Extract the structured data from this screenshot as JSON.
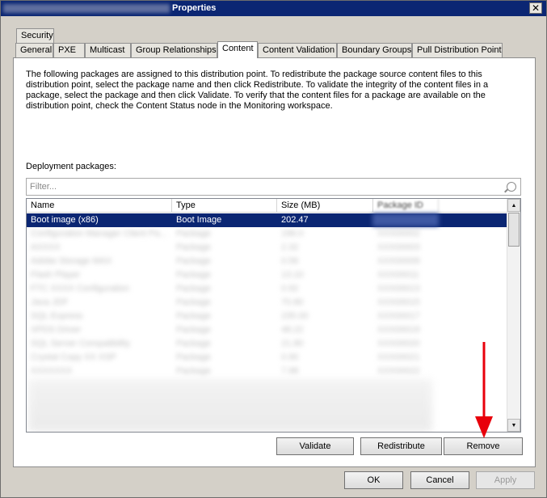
{
  "window": {
    "title": "Properties",
    "close_glyph": "✕"
  },
  "tabs": {
    "row1": [
      {
        "label": "Security"
      }
    ],
    "row2": [
      {
        "label": "General"
      },
      {
        "label": "PXE"
      },
      {
        "label": "Multicast"
      },
      {
        "label": "Group Relationships"
      },
      {
        "label": "Content",
        "active": true
      },
      {
        "label": "Content Validation"
      },
      {
        "label": "Boundary Groups"
      },
      {
        "label": "Pull Distribution Point"
      }
    ]
  },
  "content": {
    "description": "The following packages are assigned to this distribution point. To redistribute the package source content files to this distribution point, select the package name and then click Redistribute. To validate the integrity of the content files in a package, select the package and then click Validate. To verify that the content files for a package are available on the distribution point, check the Content Status node in the Monitoring workspace.",
    "deployment_label": "Deployment packages:",
    "filter_placeholder": "Filter...",
    "columns": {
      "name": "Name",
      "type": "Type",
      "size": "Size (MB)",
      "package_id": "Package ID"
    },
    "selected_row": {
      "name": "Boot image (x86)",
      "type": "Boot Image",
      "size": "202.47"
    },
    "blurred_rows": [
      {
        "name": "Configuration Manager Client Pa...",
        "type": "Package",
        "size": "196.0",
        "id": "XXX00002"
      },
      {
        "name": "AXXXX",
        "type": "Package",
        "size": "2.32",
        "id": "XXX00003"
      },
      {
        "name": "Adobe Storage MAX",
        "type": "Package",
        "size": "0.56",
        "id": "XXX00009"
      },
      {
        "name": "Flash Player",
        "type": "Package",
        "size": "13.10",
        "id": "XXX00011"
      },
      {
        "name": "FTC XXXX Configuration",
        "type": "Package",
        "size": "0.92",
        "id": "XXX00013"
      },
      {
        "name": "Java JDF",
        "type": "Package",
        "size": "70.80",
        "id": "XXX00015"
      },
      {
        "name": "SQL Express",
        "type": "Package",
        "size": "235.00",
        "id": "XXX00017"
      },
      {
        "name": "XPDS Driver",
        "type": "Package",
        "size": "48.22",
        "id": "XXX00019"
      },
      {
        "name": "SQL Server Compatibility",
        "type": "Package",
        "size": "21.80",
        "id": "XXX00020"
      },
      {
        "name": "Crystal Copy XX XSP",
        "type": "Package",
        "size": "0.90",
        "id": "XXX00021"
      },
      {
        "name": "XXXXXXX",
        "type": "Package",
        "size": "7.98",
        "id": "XXX00022"
      }
    ],
    "buttons": {
      "validate": "Validate",
      "redistribute": "Redistribute",
      "remove": "Remove"
    }
  },
  "footer": {
    "ok": "OK",
    "cancel": "Cancel",
    "apply": "Apply"
  },
  "colors": {
    "titlebar": "#0b2673",
    "selection": "#0b2673",
    "arrow": "#e8000b"
  }
}
